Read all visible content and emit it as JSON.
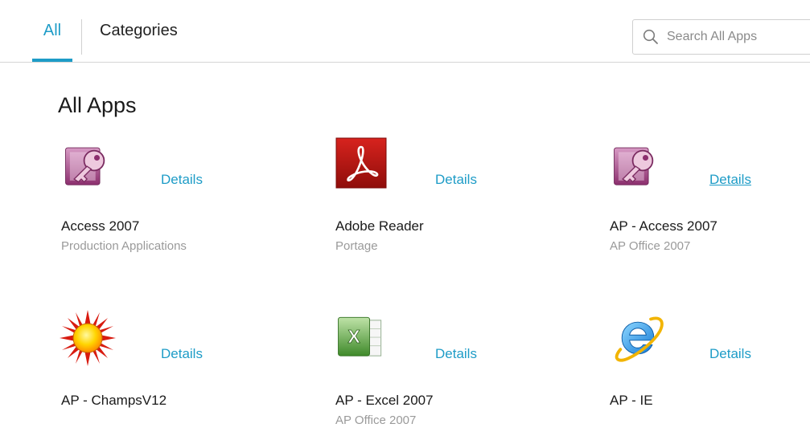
{
  "tabs": {
    "all_label": "All",
    "categories_label": "Categories"
  },
  "search": {
    "placeholder": "Search All Apps",
    "icon": "search-icon"
  },
  "section_title": "All Apps",
  "accent_color": "#1e9cc7",
  "apps": [
    {
      "name": "Access 2007",
      "category": "Production Applications",
      "details_label": "Details",
      "icon": "access-key-icon"
    },
    {
      "name": "Adobe Reader",
      "category": "Portage",
      "details_label": "Details",
      "icon": "adobe-reader-icon"
    },
    {
      "name": "AP - Access 2007",
      "category": "AP Office 2007",
      "details_label": "Details",
      "icon": "access-key-icon"
    },
    {
      "name": "AP - ChampsV12",
      "category": "",
      "details_label": "Details",
      "icon": "sunburst-icon"
    },
    {
      "name": "AP - Excel 2007",
      "category": "AP Office 2007",
      "details_label": "Details",
      "icon": "excel-icon"
    },
    {
      "name": "AP - IE",
      "category": "",
      "details_label": "Details",
      "icon": "internet-explorer-icon"
    }
  ]
}
